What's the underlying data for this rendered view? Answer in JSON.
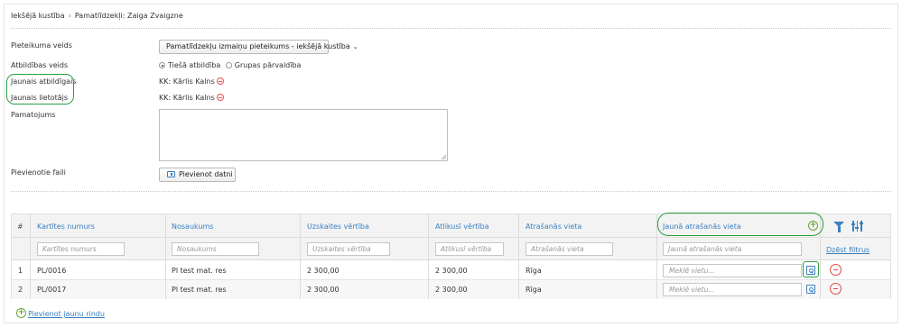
{
  "breadcrumb": {
    "items": [
      "Iekšējā kustība",
      "Pamatlīdzekļi: Zaiga Zvaigzne"
    ],
    "separator": "›"
  },
  "form": {
    "request_type_label": "Pieteikuma veids",
    "request_type_value": "Pamatlīdzekļu izmaiņu pieteikums - iekšējā kustība",
    "responsibility_type_label": "Atbildības veids",
    "responsibility_options": [
      {
        "label": "Tiešā atbildība",
        "selected": true
      },
      {
        "label": "Grupas pārvaldība",
        "selected": false
      }
    ],
    "new_responsible_label": "Jaunais atbildīgais",
    "new_responsible_value": "KK: Kārlis Kalns",
    "new_user_label": "Jaunais lietotājs",
    "new_user_value": "KK: Kārlis Kalns",
    "justification_label": "Pamatojums",
    "justification_value": "",
    "attachments_label": "Pievienotie faili",
    "add_file_button": "Pievienot datni"
  },
  "table": {
    "columns": [
      "#",
      "Kartītes numurs",
      "Nosaukums",
      "Uzskaites vērtība",
      "Atlikusī vērtība",
      "Atrašanās vieta",
      "Jaunā atrašanās vieta"
    ],
    "filter_placeholders": [
      "Kartītes numurs",
      "Nosaukums",
      "Uzskaites vērtība",
      "Atlikusī vērtība",
      "Atrašanās vieta",
      "Jaunā atrašanās vieta"
    ],
    "clear_filters": "Dzēst filtrus",
    "location_placeholder": "Meklē vietu...",
    "rows": [
      {
        "num": "1",
        "card": "PL/0016",
        "name": "Pl test mat. res",
        "book_value": "2 300,00",
        "remaining_value": "2 300,00",
        "location": "Rīga"
      },
      {
        "num": "2",
        "card": "PL/0017",
        "name": "Pl test mat. res",
        "book_value": "2 300,00",
        "remaining_value": "2 300,00",
        "location": "Rīga"
      }
    ],
    "add_row_link": "Pievienot jaunu rindu"
  },
  "colors": {
    "link": "#3a7fc1",
    "highlight": "#2c9e3e",
    "remove": "#e04848",
    "add": "#6aa533"
  }
}
